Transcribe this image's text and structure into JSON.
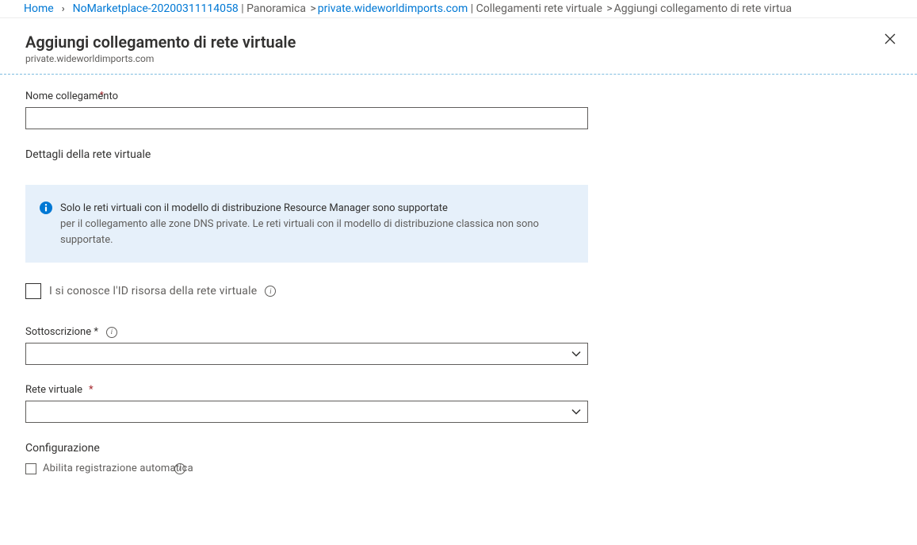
{
  "breadcrumb": {
    "home": "Home",
    "marketplace": "NoMarketplace-20200311114058",
    "panoramica": "Panoramica",
    "zone": "private.wideworldimports.com",
    "links": "Collegamenti rete virtuale",
    "current": "Aggiungi collegamento di rete virtua"
  },
  "header": {
    "title": "Aggiungi collegamento di rete virtuale",
    "subtitle": "private.wideworldimports.com"
  },
  "form": {
    "link_name_label": "Nome collegamento",
    "link_name_value": "",
    "vnet_details_heading": "Dettagli della rete virtuale",
    "info_l1": "Solo le reti virtuali con il modello di distribuzione Resource Manager sono supportate",
    "info_l2": "per il collegamento alle zone DNS private. Le reti virtuali con il modello di distribuzione classica non sono supportate.",
    "know_id_label": "I si conosce l'ID risorsa della rete virtuale",
    "subscription_label": "Sottoscrizione *",
    "subscription_value": "",
    "vnet_label": "Rete virtuale",
    "vnet_value": "",
    "config_heading": "Configurazione",
    "autoreg_label": "Abilita registrazione automatica"
  }
}
